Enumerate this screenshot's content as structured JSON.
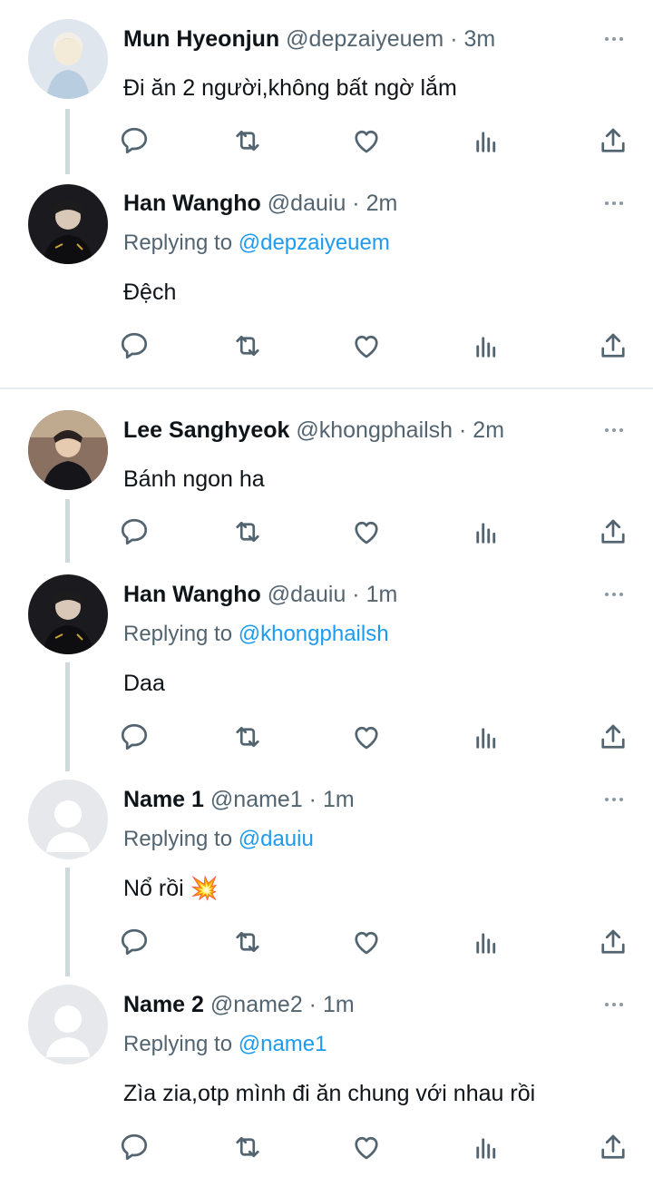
{
  "tweets": [
    {
      "name": "Mun Hyeonjun",
      "handle": "@depzaiyeuem",
      "time": "3m",
      "replying_prefix": "",
      "replying_to": "",
      "text": "Đi ăn 2 người,không bất ngờ lắm",
      "avatar": "photo-light"
    },
    {
      "name": "Han Wangho",
      "handle": "@dauiu",
      "time": "2m",
      "replying_prefix": "Replying to",
      "replying_to": "@depzaiyeuem",
      "text": "Đệch",
      "avatar": "photo-dark"
    },
    {
      "name": "Lee Sanghyeok",
      "handle": "@khongphailsh",
      "time": "2m",
      "replying_prefix": "",
      "replying_to": "",
      "text": "Bánh ngon ha",
      "avatar": "photo-warm"
    },
    {
      "name": "Han Wangho",
      "handle": "@dauiu",
      "time": "1m",
      "replying_prefix": "Replying to",
      "replying_to": "@khongphailsh",
      "text": "Daa",
      "avatar": "photo-dark"
    },
    {
      "name": "Name 1",
      "handle": "@name1",
      "time": "1m",
      "replying_prefix": "Replying to",
      "replying_to": "@dauiu",
      "text": "Nổ rồi 💥",
      "avatar": "default"
    },
    {
      "name": "Name 2",
      "handle": "@name2",
      "time": "1m",
      "replying_prefix": "Replying to",
      "replying_to": "@name1",
      "text": "Zìa zia,otp mình đi ăn chung với nhau rồi",
      "avatar": "default"
    }
  ],
  "separator": " · ",
  "more_icon": "more-horizontal-icon",
  "action_icons": [
    "reply-icon",
    "retweet-icon",
    "like-icon",
    "analytics-icon",
    "share-icon"
  ],
  "colors": {
    "text": "#0f1419",
    "secondary": "#536471",
    "mention": "#1d9bf0",
    "thread_line": "#cfd9de",
    "divider": "#e6ecf0"
  }
}
